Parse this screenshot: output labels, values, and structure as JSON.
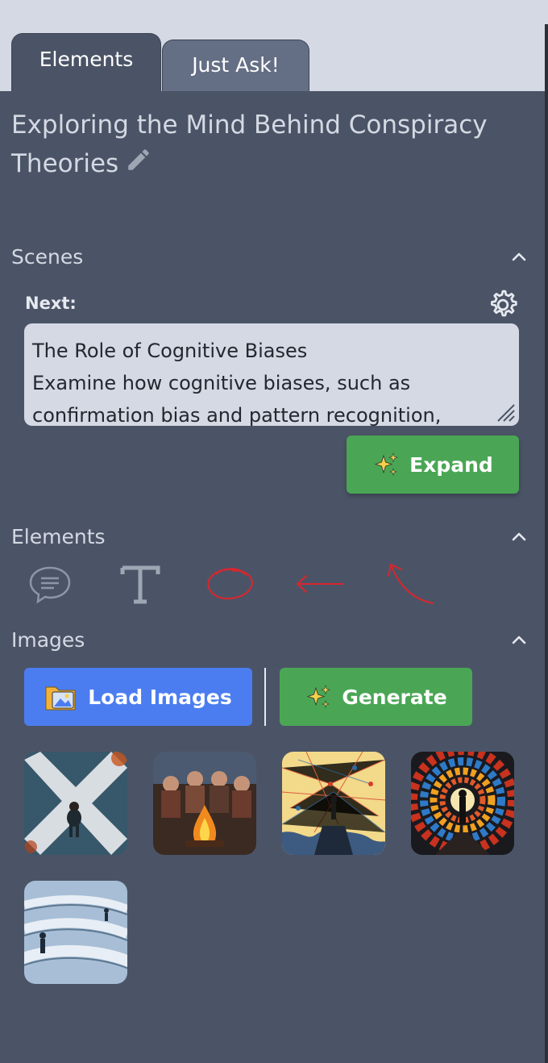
{
  "tabs": {
    "elements": "Elements",
    "just_ask": "Just Ask!"
  },
  "project": {
    "title": "Exploring the Mind Behind Conspiracy Theories"
  },
  "scenes": {
    "label": "Scenes",
    "next_label": "Next:",
    "next_text_line1": "The Role of Cognitive Biases",
    "next_text_line2": "Examine how cognitive biases, such as",
    "next_text_line3": "confirmation bias and pattern recognition,",
    "expand_label": "Expand"
  },
  "elements": {
    "label": "Elements",
    "tools": [
      "speech-bubble",
      "text",
      "circle",
      "arrow",
      "curved-arrow"
    ]
  },
  "images": {
    "label": "Images",
    "load_label": "Load Images",
    "generate_label": "Generate",
    "thumbnails": [
      "crossroads",
      "campfire",
      "network",
      "vortex",
      "maze"
    ]
  },
  "colors": {
    "panel": "#4b5466",
    "green": "#4aa655",
    "blue": "#4c7df0",
    "annotation_red": "#d9262e"
  }
}
